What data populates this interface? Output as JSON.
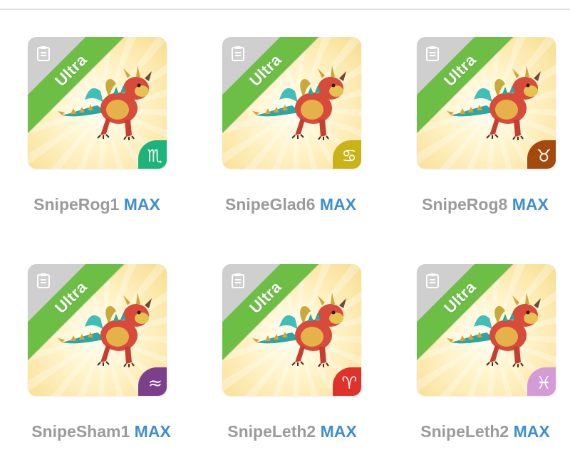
{
  "cards": [
    {
      "label": "Ultra",
      "name": "SnipeRog1",
      "level": "MAX",
      "sign_symbol": "♏",
      "sign_icon": "scorpio-icon",
      "badge_color": "#1db47c"
    },
    {
      "label": "Ultra",
      "name": "SnipeGlad6",
      "level": "MAX",
      "sign_symbol": "♋",
      "sign_icon": "cancer-icon",
      "badge_color": "#c9b316"
    },
    {
      "label": "Ultra",
      "name": "SnipeRog8",
      "level": "MAX",
      "sign_symbol": "♉",
      "sign_icon": "taurus-icon",
      "badge_color": "#a44a0c"
    },
    {
      "label": "Ultra",
      "name": "SnipeSham1",
      "level": "MAX",
      "sign_symbol": "≈",
      "sign_icon": "aquarius-icon",
      "badge_color": "#7b3f8c"
    },
    {
      "label": "Ultra",
      "name": "SnipeLeth2",
      "level": "MAX",
      "sign_symbol": "♈",
      "sign_icon": "aries-icon",
      "badge_color": "#e0322a"
    },
    {
      "label": "Ultra",
      "name": "SnipeLeth2",
      "level": "MAX",
      "sign_symbol": "♓",
      "sign_icon": "pisces-icon",
      "badge_color": "#d49bd6"
    }
  ]
}
